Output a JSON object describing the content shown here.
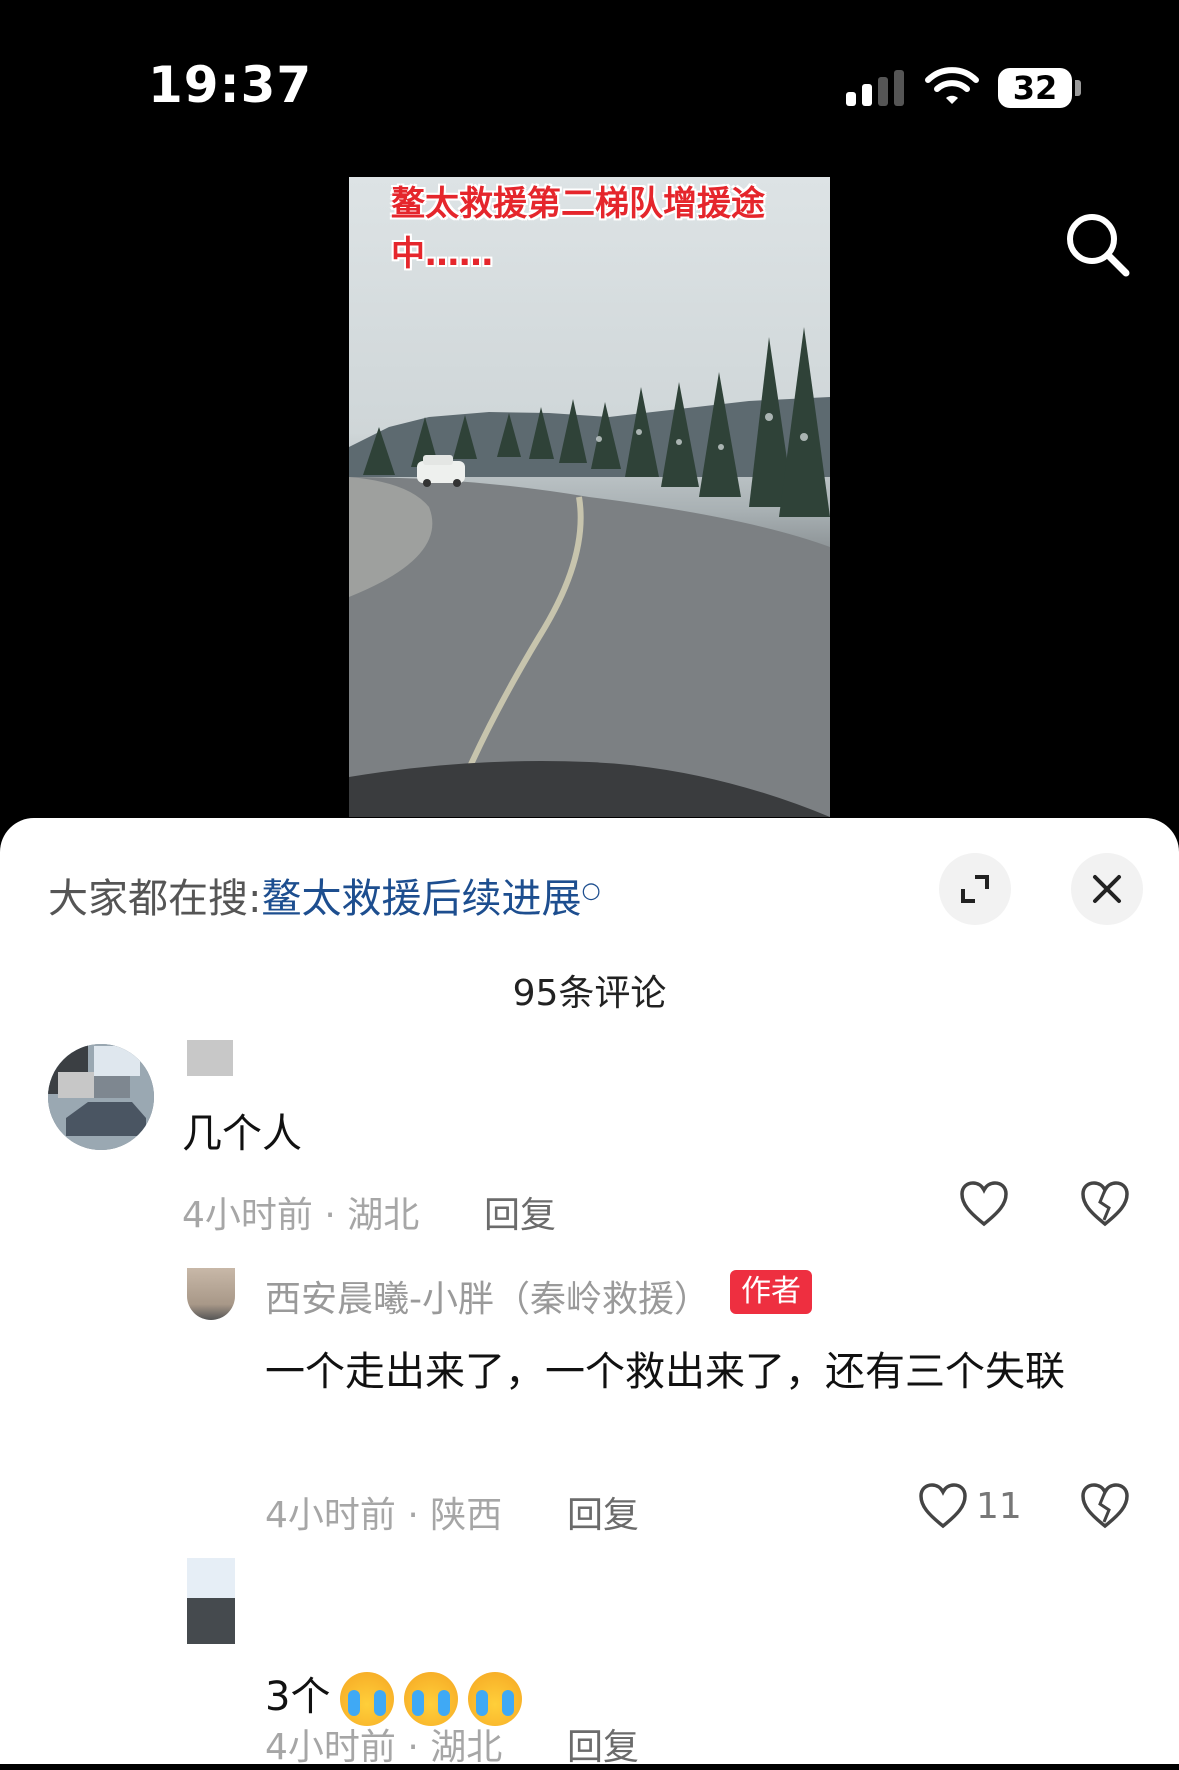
{
  "status_bar": {
    "time": "19:37",
    "battery": "32"
  },
  "video": {
    "caption": "鳌太救援第二梯队增援途中……"
  },
  "search_icon": "search-icon",
  "sheet": {
    "hot_search_prefix": "大家都在搜:",
    "hot_search_link": "鳌太救援后续进展",
    "comment_count": "95条评论"
  },
  "comments": [
    {
      "text": "几个人",
      "meta": "4小时前 · 湖北",
      "reply_label": "回复",
      "replies": [
        {
          "author": "西安晨曦-小胖（秦岭救援）",
          "badge": "作者",
          "text": "一个走出来了，一个救出来了，还有三个失联",
          "meta": "4小时前 · 陕西",
          "reply_label": "回复",
          "likes": "11"
        },
        {
          "text": "3个",
          "meta": "4小时前 · 湖北",
          "reply_label": "回复"
        }
      ]
    }
  ],
  "colors": {
    "link": "#1d4e8f",
    "badge": "#ee2f40",
    "sheet_bg": "#ffffff",
    "backdrop": "#000000"
  }
}
